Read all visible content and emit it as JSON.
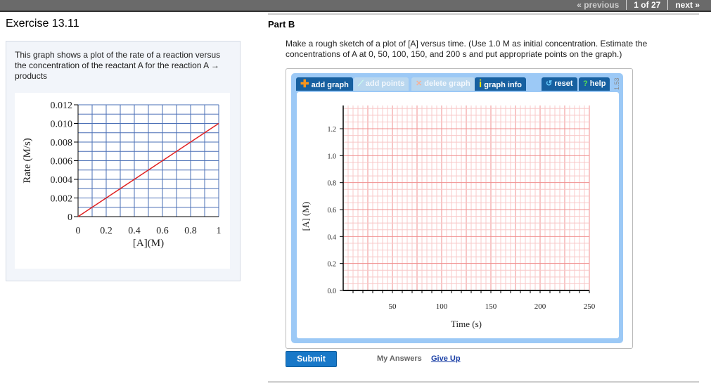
{
  "topnav": {
    "previous": "« previous",
    "position": "1 of 27",
    "next": "next »"
  },
  "exercise_title": "Exercise 13.11",
  "left": {
    "description": "This graph shows a plot of the rate of a reaction versus the concentration of the reactant A for the reaction A → products"
  },
  "part": {
    "title": "Part B",
    "prompt": "Make a rough sketch of a plot of [A] versus time. (Use 1.0 M as initial concentration. Estimate the concentrations of A at 0, 50, 100, 150, and 200 s and put appropriate points on the graph.)"
  },
  "toolbar": {
    "add_graph": "add graph",
    "add_points": "add points",
    "delete_graph": "delete graph",
    "graph_info": "graph info",
    "reset": "reset",
    "help": "help",
    "version": "1.53"
  },
  "actions": {
    "submit": "Submit",
    "my_answers": "My Answers",
    "give_up": "Give Up"
  },
  "colors": {
    "button": "#1760a0",
    "frame": "#9cc9f6",
    "line": "#e02020",
    "grid_blue": "#4a6fb5"
  },
  "chart_data": [
    {
      "type": "line",
      "xlabel": "[A](M)",
      "ylabel": "Rate (M/s)",
      "xlim": [
        0,
        1
      ],
      "ylim": [
        0,
        0.012
      ],
      "xticks": [
        "0",
        "0.2",
        "0.4",
        "0.6",
        "0.8",
        "1"
      ],
      "yticks": [
        "0",
        "0.002",
        "0.004",
        "0.006",
        "0.008",
        "0.010",
        "0.012"
      ],
      "series": [
        {
          "name": "rate",
          "x": [
            0,
            1
          ],
          "y": [
            0,
            0.01
          ]
        }
      ],
      "grid": true
    },
    {
      "type": "scatter",
      "xlabel": "Time (s)",
      "ylabel": "[A] (M)",
      "xlim": [
        0,
        250
      ],
      "ylim": [
        0,
        1.37
      ],
      "xticks": [
        "50",
        "100",
        "150",
        "200",
        "250"
      ],
      "yticks": [
        "0.0",
        "0.2",
        "0.4",
        "0.6",
        "0.8",
        "1.0",
        "1.2"
      ],
      "series": [],
      "grid": true
    }
  ]
}
